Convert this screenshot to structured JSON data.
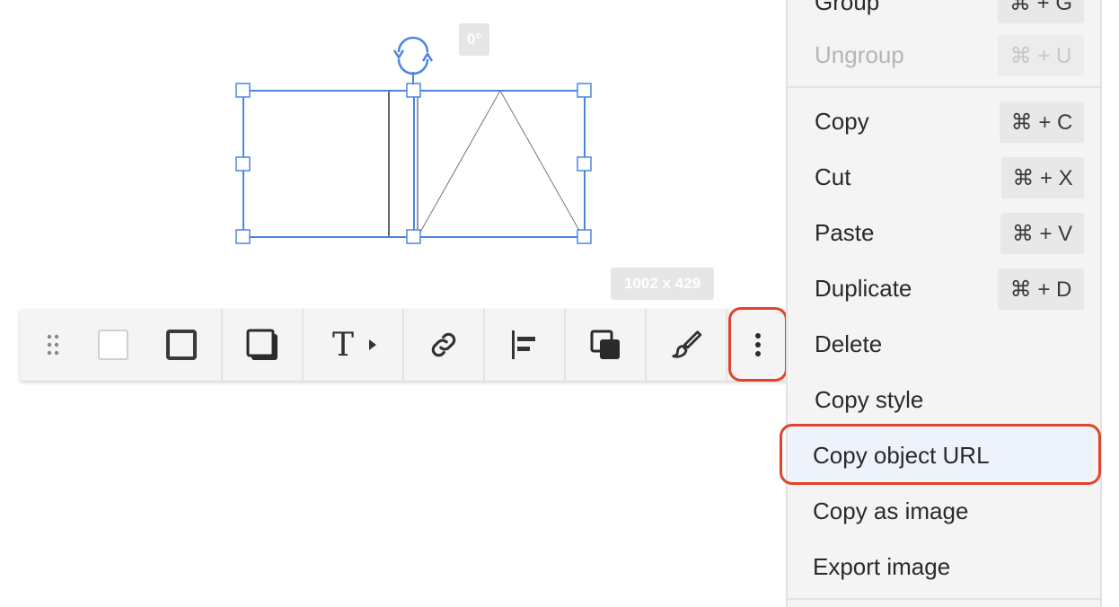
{
  "selection": {
    "rotation_label": "0°",
    "size_label": "1002 x 429"
  },
  "toolbar": {
    "items": [
      {
        "name": "drag-handle",
        "icon": "drag-dots-icon"
      },
      {
        "name": "fill-color",
        "icon": "fill-swatch-icon"
      },
      {
        "name": "border",
        "icon": "border-square-icon"
      },
      {
        "name": "shadow",
        "icon": "shadow-square-icon"
      },
      {
        "name": "text",
        "icon": "text-t-icon",
        "label": "T"
      },
      {
        "name": "link",
        "icon": "link-icon"
      },
      {
        "name": "align",
        "icon": "align-left-icon"
      },
      {
        "name": "arrange",
        "icon": "bring-to-front-icon"
      },
      {
        "name": "style",
        "icon": "paintbrush-icon"
      },
      {
        "name": "more",
        "icon": "more-vertical-icon"
      }
    ]
  },
  "menu": {
    "top_items": [
      {
        "label": "Group",
        "shortcut": "⌘ + G",
        "disabled": false
      },
      {
        "label": "Ungroup",
        "shortcut": "⌘ + U",
        "disabled": true
      }
    ],
    "items": [
      {
        "label": "Copy",
        "shortcut": "⌘ + C"
      },
      {
        "label": "Cut",
        "shortcut": "⌘ + X"
      },
      {
        "label": "Paste",
        "shortcut": "⌘ + V"
      },
      {
        "label": "Duplicate",
        "shortcut": "⌘ + D"
      },
      {
        "label": "Delete",
        "shortcut": ""
      },
      {
        "label": "Copy style",
        "shortcut": ""
      },
      {
        "label": "Copy object URL",
        "shortcut": "",
        "highlighted": true
      },
      {
        "label": "Copy as image",
        "shortcut": ""
      },
      {
        "label": "Export image",
        "shortcut": ""
      }
    ]
  },
  "colors": {
    "selection_blue": "#4a86e0",
    "highlight_red": "#e0442c"
  }
}
